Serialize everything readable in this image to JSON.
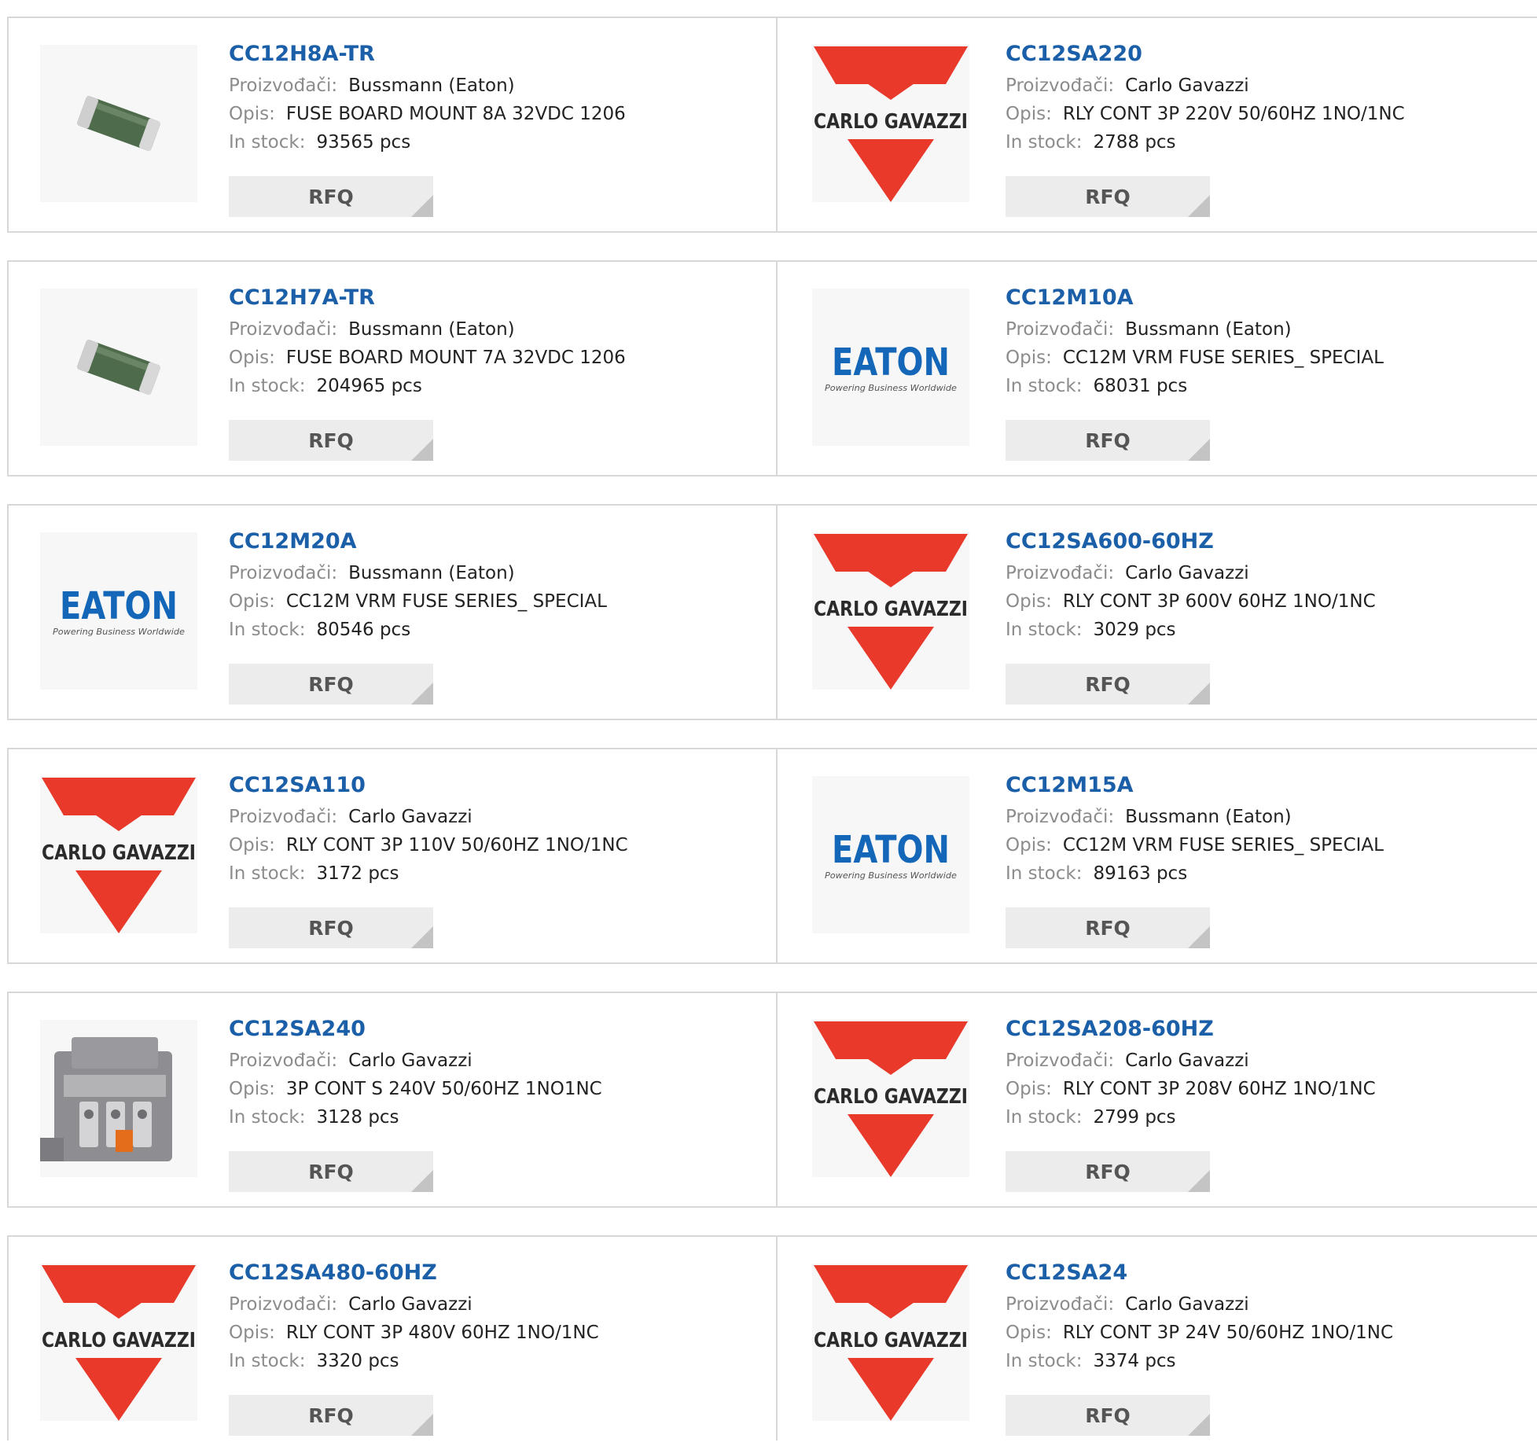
{
  "labels": {
    "manufacturer": "Proizvođači:",
    "description": "Opis:",
    "stock": "In stock:",
    "rfq": "RFQ"
  },
  "products": [
    {
      "pn": "CC12H8A-TR",
      "manufacturer": "Bussmann (Eaton)",
      "description": "FUSE BOARD MOUNT 8A 32VDC 1206",
      "stock": "93565 pcs",
      "image": "chip-fuse"
    },
    {
      "pn": "CC12SA220",
      "manufacturer": "Carlo Gavazzi",
      "description": "RLY CONT 3P 220V 50/60HZ 1NO/1NC",
      "stock": "2788 pcs",
      "image": "carlo-gavazzi-logo"
    },
    {
      "pn": "CC12H7A-TR",
      "manufacturer": "Bussmann (Eaton)",
      "description": "FUSE BOARD MOUNT 7A 32VDC 1206",
      "stock": "204965 pcs",
      "image": "chip-fuse"
    },
    {
      "pn": "CC12M10A",
      "manufacturer": "Bussmann (Eaton)",
      "description": "CC12M VRM FUSE SERIES_ SPECIAL",
      "stock": "68031 pcs",
      "image": "eaton-logo"
    },
    {
      "pn": "CC12M20A",
      "manufacturer": "Bussmann (Eaton)",
      "description": "CC12M VRM FUSE SERIES_ SPECIAL",
      "stock": "80546 pcs",
      "image": "eaton-logo"
    },
    {
      "pn": "CC12SA600-60HZ",
      "manufacturer": "Carlo Gavazzi",
      "description": "RLY CONT 3P 600V 60HZ 1NO/1NC",
      "stock": "3029 pcs",
      "image": "carlo-gavazzi-logo"
    },
    {
      "pn": "CC12SA110",
      "manufacturer": "Carlo Gavazzi",
      "description": "RLY CONT 3P 110V 50/60HZ 1NO/1NC",
      "stock": "3172 pcs",
      "image": "carlo-gavazzi-logo"
    },
    {
      "pn": "CC12M15A",
      "manufacturer": "Bussmann (Eaton)",
      "description": "CC12M VRM FUSE SERIES_ SPECIAL",
      "stock": "89163 pcs",
      "image": "eaton-logo"
    },
    {
      "pn": "CC12SA240",
      "manufacturer": "Carlo Gavazzi",
      "description": "3P CONT S 240V 50/60HZ 1NO1NC",
      "stock": "3128 pcs",
      "image": "contactor-photo"
    },
    {
      "pn": "CC12SA208-60HZ",
      "manufacturer": "Carlo Gavazzi",
      "description": "RLY CONT 3P 208V 60HZ 1NO/1NC",
      "stock": "2799 pcs",
      "image": "carlo-gavazzi-logo"
    },
    {
      "pn": "CC12SA480-60HZ",
      "manufacturer": "Carlo Gavazzi",
      "description": "RLY CONT 3P 480V 60HZ 1NO/1NC",
      "stock": "3320 pcs",
      "image": "carlo-gavazzi-logo"
    },
    {
      "pn": "CC12SA24",
      "manufacturer": "Carlo Gavazzi",
      "description": "RLY CONT 3P 24V 50/60HZ 1NO/1NC",
      "stock": "3374 pcs",
      "image": "carlo-gavazzi-logo"
    }
  ],
  "logo_text": {
    "carlo_gavazzi": "CARLO GAVAZZI",
    "eaton": "EATON",
    "eaton_tagline": "Powering Business Worldwide"
  },
  "colors": {
    "link": "#1a5fa8",
    "gavazzi_red": "#e8392b",
    "eaton_blue": "#1467b8"
  }
}
